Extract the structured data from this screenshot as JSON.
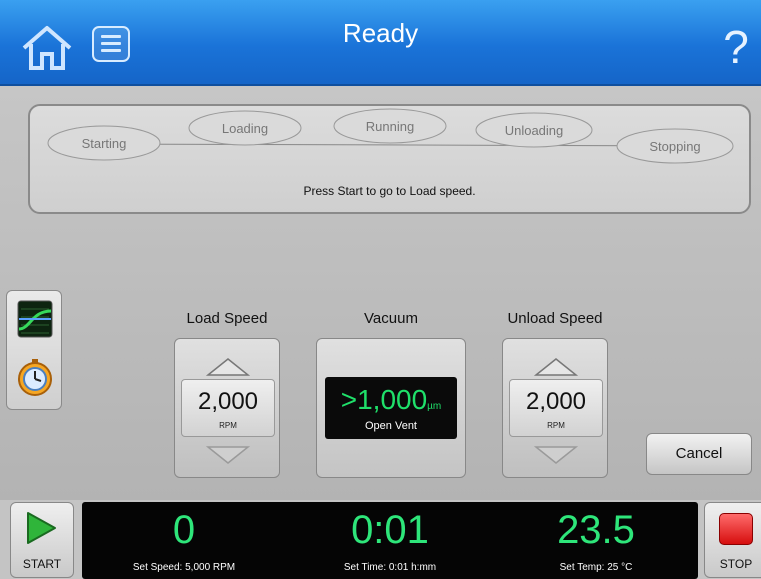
{
  "header": {
    "title": "Ready",
    "home_icon": "home-icon",
    "menu_icon": "list-icon",
    "help_icon": "help-icon",
    "help_glyph": "?"
  },
  "run_states": {
    "items": [
      "Starting",
      "Loading",
      "Running",
      "Unloading",
      "Stopping"
    ],
    "message": "Press Start to go to Load speed."
  },
  "side_tabs": {
    "graph_icon": "graph-icon",
    "timer_icon": "timer-icon"
  },
  "controls": {
    "load_speed": {
      "label": "Load Speed",
      "value": "2,000",
      "unit": "RPM"
    },
    "vacuum": {
      "label": "Vacuum",
      "value": ">1,000",
      "unit": "µm",
      "status": "Open Vent"
    },
    "unload_speed": {
      "label": "Unload Speed",
      "value": "2,000",
      "unit": "RPM"
    },
    "cancel_label": "Cancel"
  },
  "footer": {
    "start_label": "START",
    "stop_label": "STOP",
    "speed": {
      "value": "0",
      "set": "Set Speed: 5,000 RPM"
    },
    "time": {
      "value": "0:01",
      "set": "Set Time: 0:01 h:mm"
    },
    "temp": {
      "value": "23.5",
      "set": "Set Temp: 25 °C"
    }
  },
  "colors": {
    "header_blue": "#1a73d8",
    "readout_green": "#2ee67a",
    "stop_red": "#d60e0e",
    "start_green": "#2fb53a"
  }
}
